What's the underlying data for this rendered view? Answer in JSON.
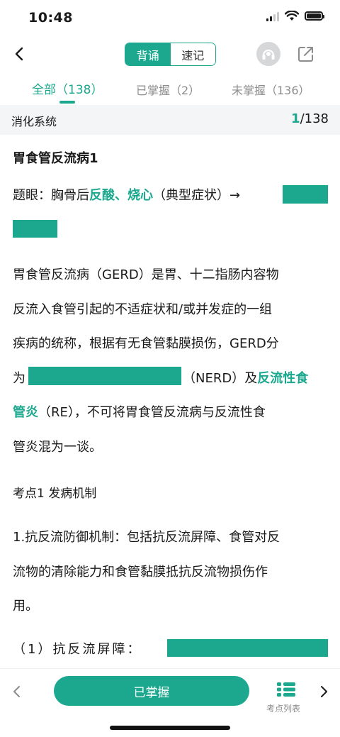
{
  "status": {
    "time": "10:48"
  },
  "nav": {
    "seg_active": "背诵",
    "seg_inactive": "速记"
  },
  "tabs": {
    "all": "全部（138）",
    "mastered": "已掌握（2）",
    "unmastered": "未掌握（136）"
  },
  "category": {
    "name": "消化系统",
    "current": "1",
    "total": "/138"
  },
  "content": {
    "title": "胃食管反流病1",
    "hint_prefix": "题眼：胸骨后",
    "hint_key": "反酸、烧心",
    "hint_suffix": "（典型症状）→",
    "para1_l1": "胃食管反流病（GERD）是胃、十二指肠内容物",
    "para1_l2": "反流入食管引起的不适症状和/或并发症的一组",
    "para1_l3": "疾病的统称，根据有无食管黏膜损伤，GERD分",
    "para1_l4_prefix": "为",
    "para1_l4_mid": "（NERD）及",
    "para1_l4_key": "反流性食",
    "para1_l5_key": "管炎",
    "para1_l5_rest": "（RE），不可将胃食管反流病与反流性食",
    "para1_l6": "管炎混为一谈。",
    "point1": "考点1 发病机制",
    "para2_l1": "1.抗反流防御机制：包括抗反流屏障、食管对反",
    "para2_l2": "流物的清除能力和食管黏膜抵抗反流物损伤作",
    "para2_l3": "用。",
    "item1": "（1）抗反流屏障："
  },
  "bottom": {
    "mastered_button": "已掌握",
    "list_label": "考点列表"
  },
  "colors": {
    "accent": "#1ba88e"
  }
}
